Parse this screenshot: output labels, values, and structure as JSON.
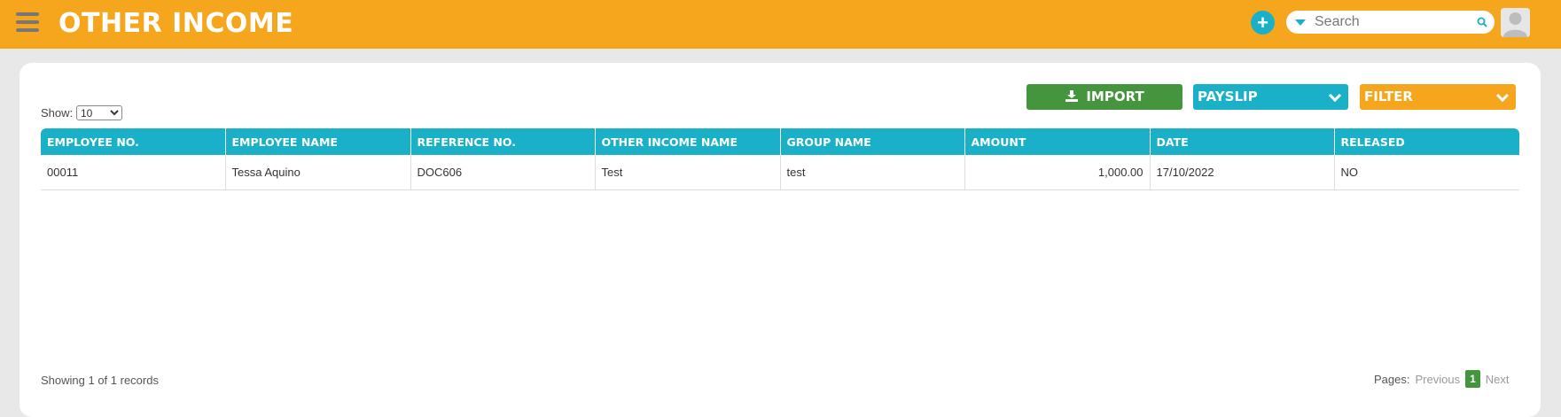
{
  "header": {
    "title": "OTHER INCOME",
    "search_placeholder": "Search",
    "accent_color": "#f5a61d",
    "teal_color": "#1ab1c8",
    "add_label": "+"
  },
  "controls": {
    "show_label": "Show:",
    "page_size": "10",
    "page_size_options": [
      "10"
    ],
    "import_label": "IMPORT",
    "payslip_label": "PAYSLIP",
    "filter_label": "FILTER"
  },
  "table": {
    "columns": [
      "EMPLOYEE NO.",
      "EMPLOYEE NAME",
      "REFERENCE NO.",
      "OTHER INCOME NAME",
      "GROUP NAME",
      "AMOUNT",
      "DATE",
      "RELEASED"
    ],
    "rows": [
      [
        "00011",
        "Tessa Aquino",
        "DOC606",
        "Test",
        "test",
        "1,000.00",
        "17/10/2022",
        "NO"
      ]
    ]
  },
  "footer": {
    "showing": "Showing 1 of 1 records",
    "pages_label": "Pages:",
    "previous": "Previous",
    "current_page": "1",
    "next": "Next"
  }
}
